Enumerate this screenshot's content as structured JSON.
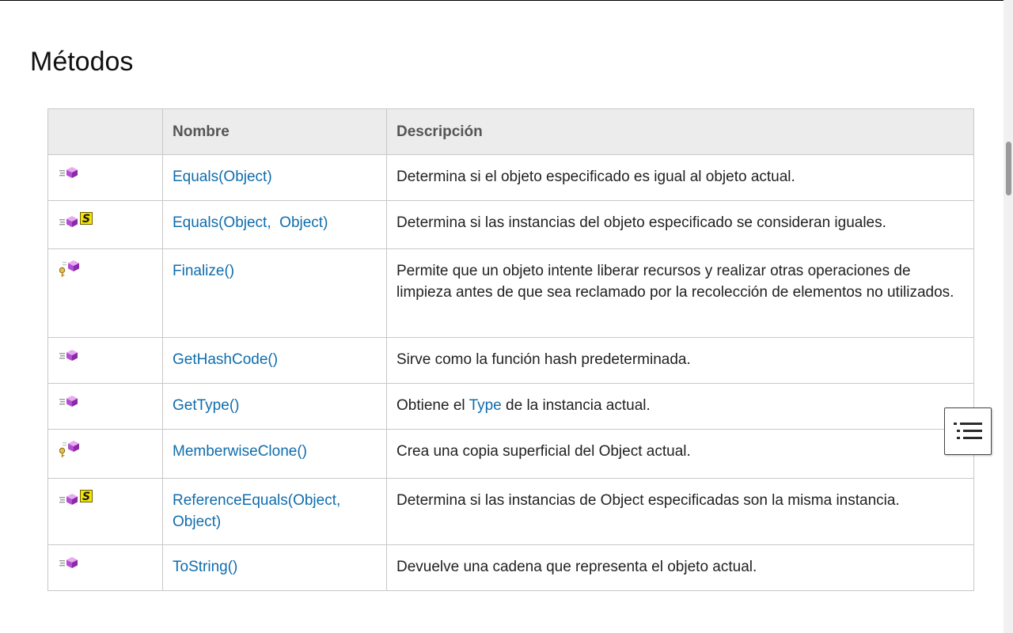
{
  "page": {
    "title": "Métodos"
  },
  "table": {
    "headers": {
      "icon": "",
      "name": "Nombre",
      "description": "Descripción"
    },
    "rows": [
      {
        "icons": [
          "public-method-icon"
        ],
        "name": "Equals(Object)",
        "description": "Determina si el objeto especificado es igual al objeto actual."
      },
      {
        "icons": [
          "public-method-icon",
          "static-icon"
        ],
        "name": "Equals(Object,  Object)",
        "description": "Determina si las instancias del objeto especificado se consideran iguales."
      },
      {
        "icons": [
          "protected-method-icon"
        ],
        "name": "Finalize()",
        "description": "Permite que un objeto intente liberar recursos y realizar otras operaciones de limpieza antes de que sea reclamado por la recolección de elementos no utilizados."
      },
      {
        "icons": [
          "public-method-icon"
        ],
        "name": "GetHashCode()",
        "description": "Sirve como la función hash predeterminada."
      },
      {
        "icons": [
          "public-method-icon"
        ],
        "name": "GetType()",
        "description_pre": "Obtiene el ",
        "description_link": "Type",
        "description_post": " de la instancia actual."
      },
      {
        "icons": [
          "protected-method-icon"
        ],
        "name": "MemberwiseClone()",
        "description": "Crea una copia superficial del Object actual."
      },
      {
        "icons": [
          "public-method-icon",
          "static-icon"
        ],
        "name": "ReferenceEquals(Object, Object)",
        "description": "Determina si las instancias de Object especificadas son la misma instancia."
      },
      {
        "icons": [
          "public-method-icon"
        ],
        "name": "ToString()",
        "description": "Devuelve una cadena que representa el objeto actual."
      }
    ]
  },
  "floating": {
    "toc_icon": "list-icon"
  },
  "colors": {
    "link": "#0f6dad",
    "header_bg": "#ececec",
    "border": "#c8c8c8",
    "method_purple": "#b24fd0",
    "static_yellow": "#f5e400"
  }
}
